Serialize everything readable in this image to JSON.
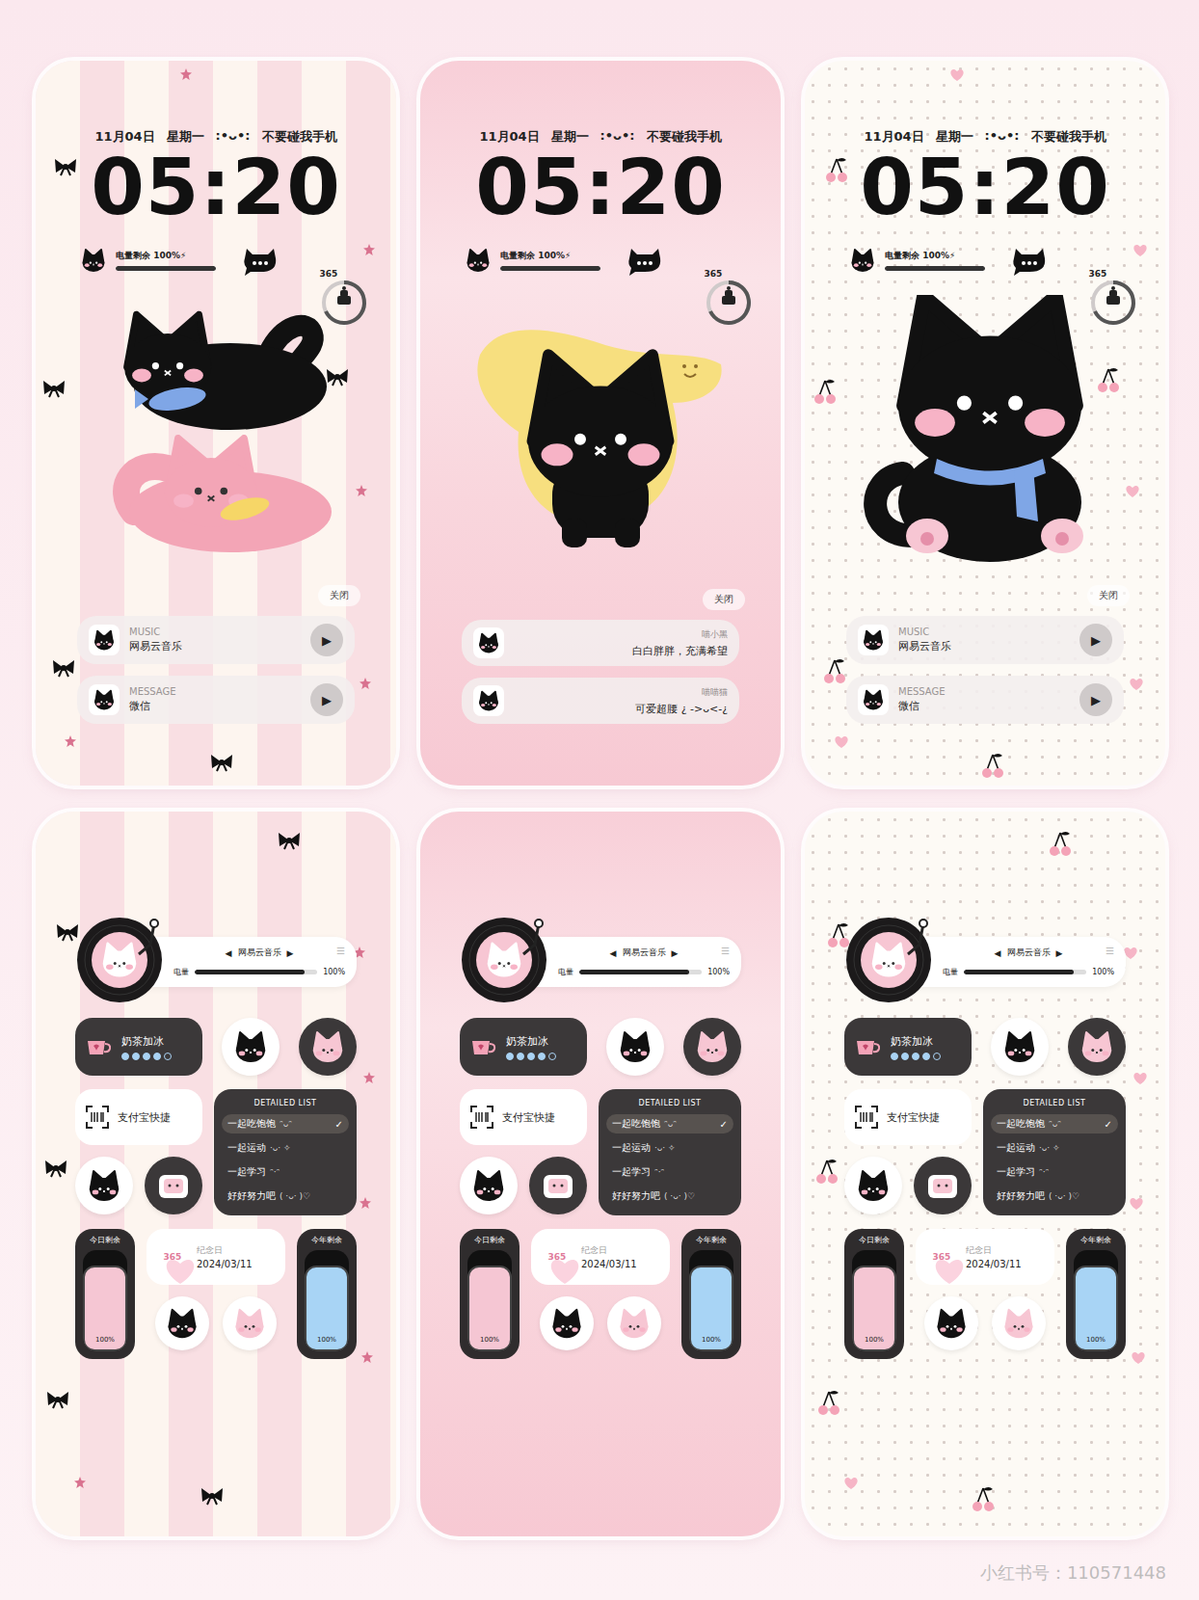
{
  "lock_screens": [
    {
      "kind": "stripes",
      "date": "11月04日",
      "weekday": "星期一",
      "kaomoji": ":•ᴗ•:",
      "note": "不要碰我手机",
      "time": "05:20",
      "battery": {
        "label": "电量剩余 100%",
        "icon": "⚡",
        "level": 1
      },
      "badge": "365",
      "close": "关闭",
      "cards": [
        {
          "kind": "player",
          "label": "MUSIC",
          "app": "网易云音乐",
          "button": "▶"
        },
        {
          "kind": "player",
          "label": "MESSAGE",
          "app": "微信",
          "button": "▶"
        }
      ]
    },
    {
      "kind": "pink",
      "date": "11月04日",
      "weekday": "星期一",
      "kaomoji": ":•ᴗ•:",
      "note": "不要碰我手机",
      "time": "05:20",
      "battery": {
        "label": "电量剩余 100%",
        "icon": "⚡",
        "level": 1
      },
      "badge": "365",
      "close": "关闭",
      "cards": [
        {
          "kind": "note",
          "name": "喵小黑",
          "text": "白白胖胖，充满希望"
        },
        {
          "kind": "note",
          "name": "喵喵猫",
          "text": "可爱超腰 ¿ ->ᴗ<-¿"
        }
      ]
    },
    {
      "kind": "dots",
      "date": "11月04日",
      "weekday": "星期一",
      "kaomoji": ":•ᴗ•:",
      "note": "不要碰我手机",
      "time": "05:20",
      "battery": {
        "label": "电量剩余 100%",
        "icon": "⚡",
        "level": 1
      },
      "badge": "365",
      "close": "关闭",
      "cards": [
        {
          "kind": "player",
          "label": "MUSIC",
          "app": "网易云音乐",
          "button": "▶"
        },
        {
          "kind": "player",
          "label": "MESSAGE",
          "app": "微信",
          "button": "▶"
        }
      ]
    }
  ],
  "home_screens": [
    {
      "kind": "stripes",
      "player": {
        "prev": "◀",
        "title": "网易云音乐",
        "next": "▶",
        "menu": "☰",
        "label": "电量",
        "reading": "100%",
        "level": 0.9
      },
      "tea": {
        "label": "奶茶加冰",
        "stars": 4
      },
      "alipay": "支付宝快捷",
      "list": {
        "title": "DETAILED LIST",
        "check_mark": "✓",
        "items": [
          {
            "label": "一起吃饱饱",
            "deco": "ᵔᴗᵔ",
            "checked": true
          },
          {
            "label": "一起运动",
            "deco": "·ᴗ· ✧",
            "checked": false
          },
          {
            "label": "一起学习",
            "deco": "ᵔ·ᵔ",
            "checked": false
          },
          {
            "label": "好好努力吧",
            "deco": "( ·ᴗ· )♡",
            "checked": false
          }
        ]
      },
      "today": {
        "label": "今日剩余",
        "reading": "100%",
        "level": 1
      },
      "anniversary": {
        "badge": "365",
        "label": "纪念日",
        "date": "2024/03/11"
      },
      "year": {
        "label": "今年剩余",
        "reading": "100%",
        "level": 1
      }
    },
    {
      "kind": "pink",
      "player": {
        "prev": "◀",
        "title": "网易云音乐",
        "next": "▶",
        "menu": "☰",
        "label": "电量",
        "reading": "100%",
        "level": 0.9
      },
      "tea": {
        "label": "奶茶加冰",
        "stars": 4
      },
      "alipay": "支付宝快捷",
      "list": {
        "title": "DETAILED LIST",
        "check_mark": "✓",
        "items": [
          {
            "label": "一起吃饱饱",
            "deco": "ᵔᴗᵔ",
            "checked": true
          },
          {
            "label": "一起运动",
            "deco": "·ᴗ· ✧",
            "checked": false
          },
          {
            "label": "一起学习",
            "deco": "ᵔ·ᵔ",
            "checked": false
          },
          {
            "label": "好好努力吧",
            "deco": "( ·ᴗ· )♡",
            "checked": false
          }
        ]
      },
      "today": {
        "label": "今日剩余",
        "reading": "100%",
        "level": 1
      },
      "anniversary": {
        "badge": "365",
        "label": "纪念日",
        "date": "2024/03/11"
      },
      "year": {
        "label": "今年剩余",
        "reading": "100%",
        "level": 1
      }
    },
    {
      "kind": "dots",
      "player": {
        "prev": "◀",
        "title": "网易云音乐",
        "next": "▶",
        "menu": "☰",
        "label": "电量",
        "reading": "100%",
        "level": 0.9
      },
      "tea": {
        "label": "奶茶加冰",
        "stars": 4
      },
      "alipay": "支付宝快捷",
      "list": {
        "title": "DETAILED LIST",
        "check_mark": "✓",
        "items": [
          {
            "label": "一起吃饱饱",
            "deco": "ᵔᴗᵔ",
            "checked": true
          },
          {
            "label": "一起运动",
            "deco": "·ᴗ· ✧",
            "checked": false
          },
          {
            "label": "一起学习",
            "deco": "ᵔ·ᵔ",
            "checked": false
          },
          {
            "label": "好好努力吧",
            "deco": "( ·ᴗ· )♡",
            "checked": false
          }
        ]
      },
      "today": {
        "label": "今日剩余",
        "reading": "100%",
        "level": 1
      },
      "anniversary": {
        "badge": "365",
        "label": "纪念日",
        "date": "2024/03/11"
      },
      "year": {
        "label": "今年剩余",
        "reading": "100%",
        "level": 1
      }
    }
  ],
  "watermark": "小红书号：110571448"
}
